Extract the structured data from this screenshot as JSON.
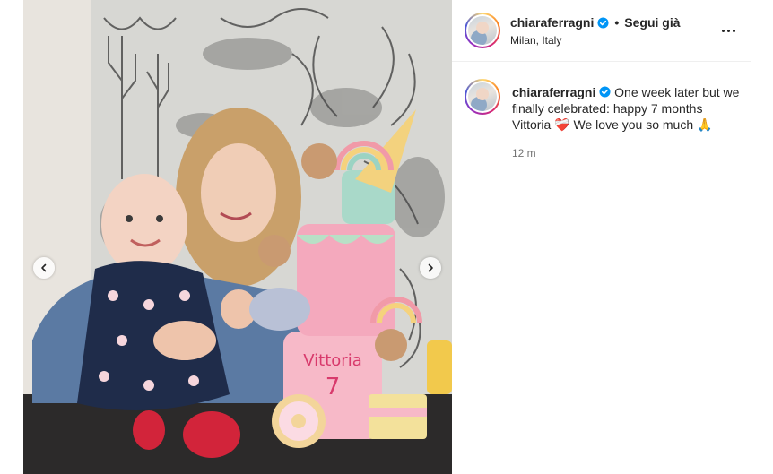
{
  "post": {
    "username": "chiaraferragni",
    "follow_separator": "•",
    "follow_label": "Segui già",
    "location": "Milan, Italy",
    "caption": {
      "username": "chiaraferragni",
      "text_part1": "One week later but we finally celebrated: happy 7 months Vittoria",
      "emoji_heart": "❤️‍🩹",
      "text_part2": "We love you so much",
      "emoji_pray": "🙏"
    },
    "timestamp": "12 m"
  },
  "photo": {
    "cake_text": "Vittoria",
    "cake_number": "7"
  },
  "icons": {
    "verified": "verified-badge-icon",
    "more": "more-options-icon",
    "prev": "chevron-left-icon",
    "next": "chevron-right-icon"
  },
  "colors": {
    "verified_blue": "#0095f6",
    "text_primary": "#262626",
    "text_secondary": "#737373",
    "cake_pink": "#f7b9c8"
  }
}
